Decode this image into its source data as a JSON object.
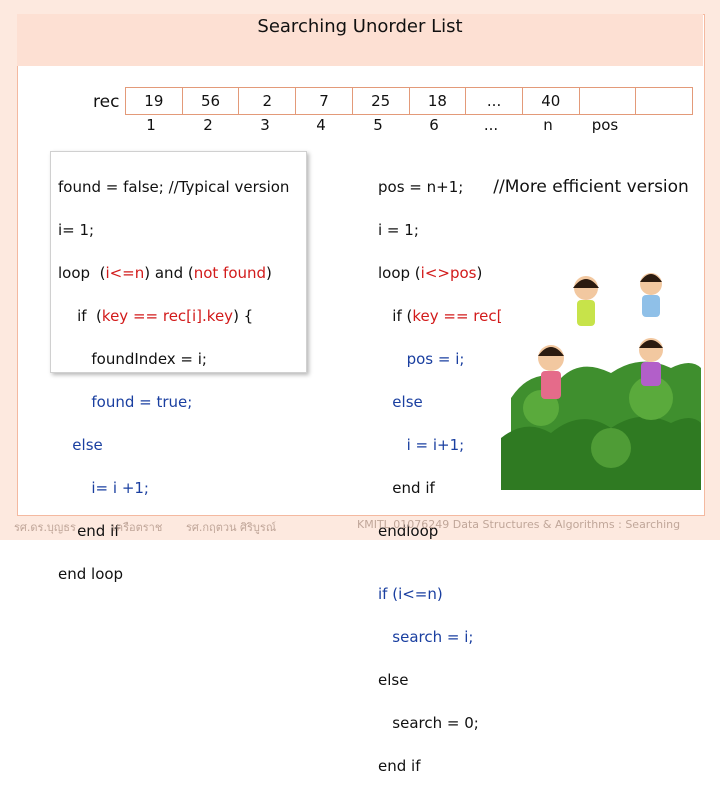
{
  "title": "Searching Unorder List",
  "rec_label": "rec",
  "array": {
    "values": [
      "19",
      "56",
      "2",
      "7",
      "25",
      "18",
      "...",
      "40",
      "",
      ""
    ],
    "indices": [
      "1",
      "2",
      "3",
      "4",
      "5",
      "6",
      "...",
      "n",
      "pos"
    ]
  },
  "left_code": {
    "l1": "found = false; //Typical version",
    "l2": "i= 1;",
    "l3a": "loop  (",
    "l3b": "i<=n",
    "l3c": ") and (",
    "l3d": "not found",
    "l3e": ")",
    "l4a": "    if  (",
    "l4b": "key == rec[i].key",
    "l4c": ") {",
    "l5": "       foundIndex = i;",
    "l6": "       found = true;",
    "l7": "   else",
    "l8": "       i= i +1;",
    "l9": "    end if",
    "l10": "end loop"
  },
  "right_code": {
    "l1": "pos = n+1;",
    "comment": "//More efficient version",
    "l2": "i = 1;",
    "l3a": "loop (",
    "l3b": "i<>pos",
    "l3c": ")",
    "l4a": "   if (",
    "l4b": "key == rec[i].key",
    "l4c": ")",
    "l5": "      pos = i;",
    "l6": "   else",
    "l7": "      i = i+1;",
    "l8": "   end if",
    "l9": "endloop",
    "l10": "if (i<=n)",
    "l11": "   search = i;",
    "l12": "else",
    "l13": "   search = 0;",
    "l14": "end if"
  },
  "footer": {
    "author1": "รศ.ดร.บุญธร",
    "author1b": "เครือตราช",
    "author2": "รศ.กฤตวน   ศิริบูรณ์",
    "course": "KMITL   01076249 Data Structures & Algorithms : Searching"
  },
  "colors": {
    "accent_border": "#e39a79",
    "title_bg": "#fde0d3",
    "keyword_red": "#d21b1b",
    "keyword_blue": "#1a3fa0"
  }
}
